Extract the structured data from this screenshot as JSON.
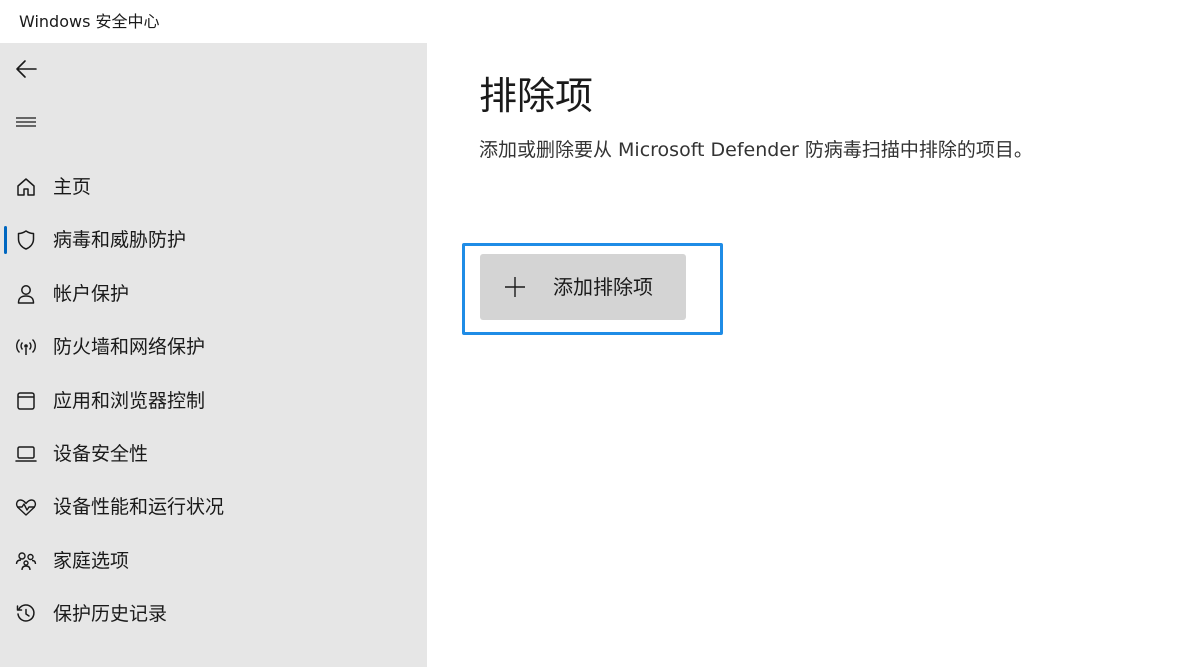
{
  "window": {
    "title": "Windows 安全中心"
  },
  "sidebar": {
    "back_icon": "back-arrow-icon",
    "menu_icon": "hamburger-menu-icon",
    "items": [
      {
        "label": "主页",
        "icon": "home-icon",
        "selected": false
      },
      {
        "label": "病毒和威胁防护",
        "icon": "shield-icon",
        "selected": true
      },
      {
        "label": "帐户保护",
        "icon": "person-icon",
        "selected": false
      },
      {
        "label": "防火墙和网络保护",
        "icon": "wireless-signal-icon",
        "selected": false
      },
      {
        "label": "应用和浏览器控制",
        "icon": "browser-window-icon",
        "selected": false
      },
      {
        "label": "设备安全性",
        "icon": "laptop-icon",
        "selected": false
      },
      {
        "label": "设备性能和运行状况",
        "icon": "heart-pulse-icon",
        "selected": false
      },
      {
        "label": "家庭选项",
        "icon": "family-icon",
        "selected": false
      },
      {
        "label": "保护历史记录",
        "icon": "history-icon",
        "selected": false
      }
    ]
  },
  "main": {
    "title": "排除项",
    "description": "添加或删除要从 Microsoft Defender 防病毒扫描中排除的项目。",
    "add_button": {
      "label": "添加排除项",
      "icon": "plus-icon"
    }
  },
  "colors": {
    "sidebar_bg": "#e6e6e6",
    "accent": "#0067c0",
    "focus_ring": "#1f8ce6",
    "button_bg": "#d4d4d4"
  }
}
